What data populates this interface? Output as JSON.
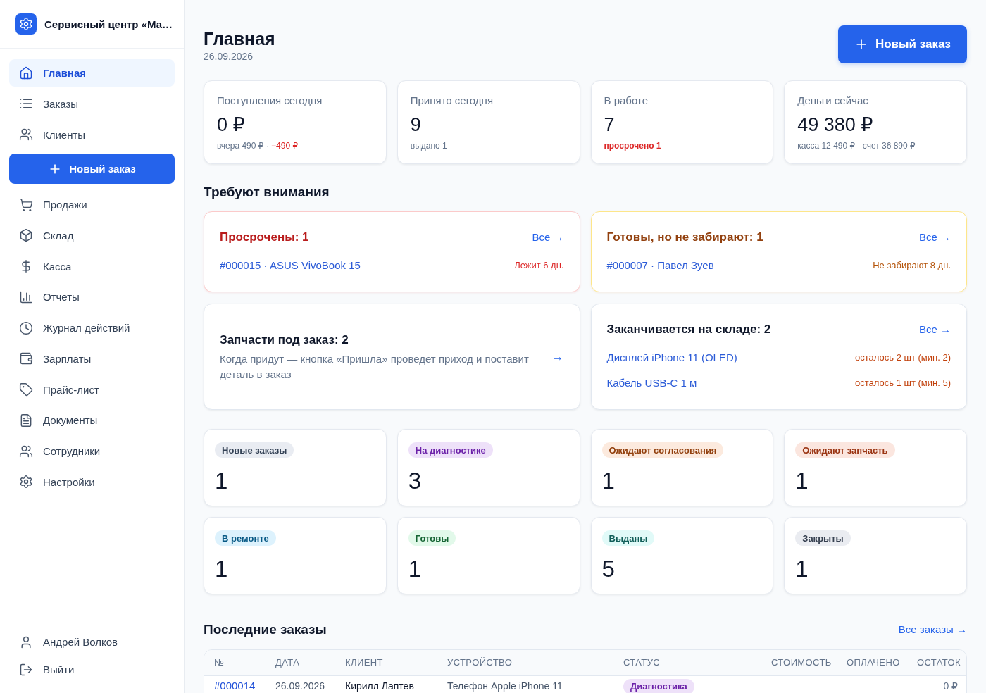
{
  "sidebar": {
    "title": "Сервисный центр «Ма…",
    "primary_nav": [
      {
        "label": "Главная",
        "selected": true
      },
      {
        "label": "Заказы",
        "selected": false
      },
      {
        "label": "Клиенты",
        "selected": false
      }
    ],
    "new_order_button": {
      "label": "Новый заказ"
    },
    "nav": [
      {
        "label": "Продажи",
        "selected": false
      },
      {
        "label": "Склад",
        "selected": false
      },
      {
        "label": "Касса",
        "selected": false
      },
      {
        "label": "Отчеты",
        "selected": false
      },
      {
        "label": "Журнал действий",
        "selected": false
      },
      {
        "label": "Зарплаты",
        "selected": false
      },
      {
        "label": "Прайс-лист",
        "selected": false
      },
      {
        "label": "Документы",
        "selected": false
      },
      {
        "label": "Сотрудники",
        "selected": false
      },
      {
        "label": "Настройки",
        "selected": false
      }
    ],
    "user": {
      "name": "Андрей Волков"
    },
    "logout": {
      "label": "Выйти"
    }
  },
  "header": {
    "title": "Главная",
    "date": "26.09.2026",
    "new_order_button": {
      "label": "Новый заказ"
    }
  },
  "stats": [
    {
      "label": "Поступления сегодня",
      "value": "0 ₽",
      "note": [
        {
          "text": "вчера 490 ₽ ·",
          "color": "#64748b",
          "strong": false
        },
        {
          "text": "−490 ₽",
          "color": "#dc2626",
          "strong": false
        }
      ]
    },
    {
      "label": "Принято сегодня",
      "value": "9",
      "note": [
        {
          "text": "выдано 1",
          "color": "#64748b",
          "strong": false
        }
      ]
    },
    {
      "label": "В работе",
      "value": "7",
      "note": [
        {
          "text": "просрочено 1",
          "color": "#dc2626",
          "strong": true
        }
      ]
    },
    {
      "label": "Деньги сейчас",
      "value": "49 380 ₽",
      "note": [
        {
          "text": "касса 12 490 ₽ · счет 36 890 ₽",
          "color": "#64748b",
          "strong": false
        }
      ]
    }
  ],
  "attention": {
    "title": "Требуют внимания",
    "columns": [
      [
        {
          "kind": "danger",
          "title": "Просрочены: 1",
          "link": "Все →",
          "items": [
            {
              "label": "#000015 · ASUS VivoBook 15",
              "note": "Лежит 6 дн."
            }
          ]
        },
        {
          "kind": "note",
          "title": "Запчасти под заказ: 2",
          "text": "Когда придут — кнопка «Пришла» проведет приход и поставит деталь в заказ",
          "link": "→"
        }
      ],
      [
        {
          "kind": "warning",
          "title": "Готовы, но не забирают: 1",
          "link": "Все →",
          "items": [
            {
              "label": "#000007 · Павел Зуев",
              "note": "Не забирают 8 дн."
            }
          ]
        },
        {
          "kind": "list",
          "title": "Заканчивается на складе: 2",
          "link": "Все →",
          "items": [
            {
              "label": "Дисплей iPhone 11 (OLED)",
              "note": "осталось 2 шт (мин. 2)"
            },
            {
              "label": "Кабель USB-C 1 м",
              "note": "осталось 1 шт (мин. 5)"
            }
          ]
        }
      ]
    ]
  },
  "statuses": [
    {
      "label": "Новые заказы",
      "count": "1",
      "color": "#334155"
    },
    {
      "label": "На диагностике",
      "count": "3",
      "color": "#6b21a8"
    },
    {
      "label": "Ожидают согласования",
      "count": "1",
      "color": "#92400e"
    },
    {
      "label": "Ожидают запчасть",
      "count": "1",
      "color": "#9a3412"
    },
    {
      "label": "В ремонте",
      "count": "1",
      "color": "#075985"
    },
    {
      "label": "Готовы",
      "count": "1",
      "color": "#166534"
    },
    {
      "label": "Выданы",
      "count": "5",
      "color": "#115e59"
    },
    {
      "label": "Закрыты",
      "count": "1",
      "color": "#374151"
    }
  ],
  "recent_orders": {
    "title": "Последние заказы",
    "link": "Все заказы →",
    "columns": [
      "№",
      "ДАТА",
      "КЛИЕНТ",
      "УСТРОЙСТВО",
      "СТАТУС",
      "СТОИМОСТЬ",
      "ОПЛАЧЕНО",
      "ОСТАТОК"
    ],
    "rows": [
      {
        "number": "#000014",
        "date": "26.09.2026",
        "client": "Кирилл Лаптев",
        "device": "Телефон Apple iPhone 11",
        "status": {
          "label": "Диагностика",
          "color": "#6b21a8"
        },
        "cost": "—",
        "paid": "—",
        "balance": "0 ₽"
      }
    ]
  }
}
